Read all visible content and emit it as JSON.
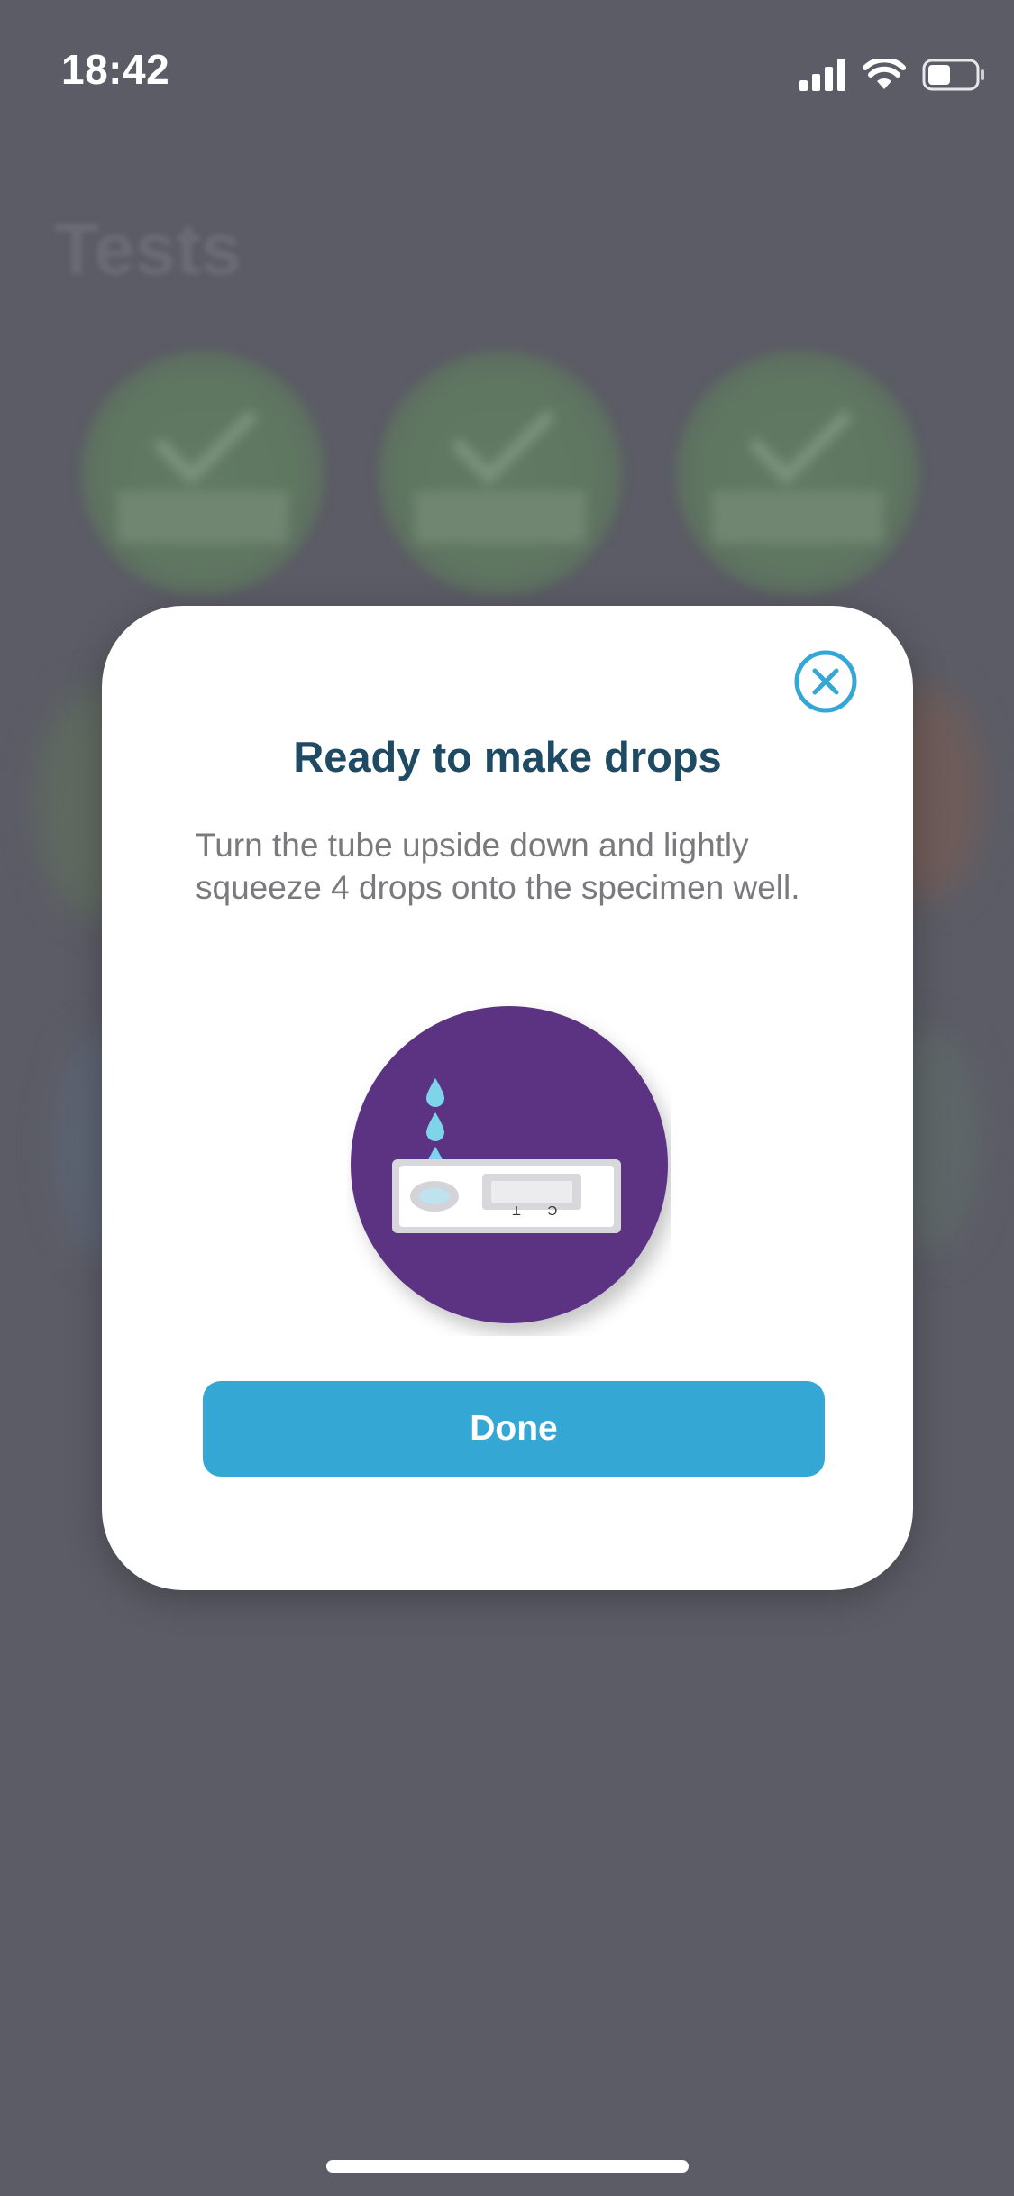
{
  "status_bar": {
    "time": "18:42",
    "icons": [
      "cellular-signal-icon",
      "wifi-icon",
      "battery-icon"
    ]
  },
  "background": {
    "title": "Tests"
  },
  "modal": {
    "title": "Ready to make drops",
    "description": "Turn the tube upside down and lightly squeeze 4 drops onto the specimen well.",
    "illustration": {
      "icon": "test-cassette-drops-illustration",
      "cassette_labels": {
        "t": "T",
        "c": "C"
      }
    },
    "done_label": "Done",
    "close_icon": "close-icon"
  },
  "colors": {
    "overlay_background": "#5b5c65",
    "modal_background": "#ffffff",
    "title_color": "#1e4a63",
    "description_color": "#7a7a7e",
    "accent_blue": "#35a7d5",
    "illustration_purple": "#5c3282",
    "drop_blue": "#7fd4ea"
  }
}
